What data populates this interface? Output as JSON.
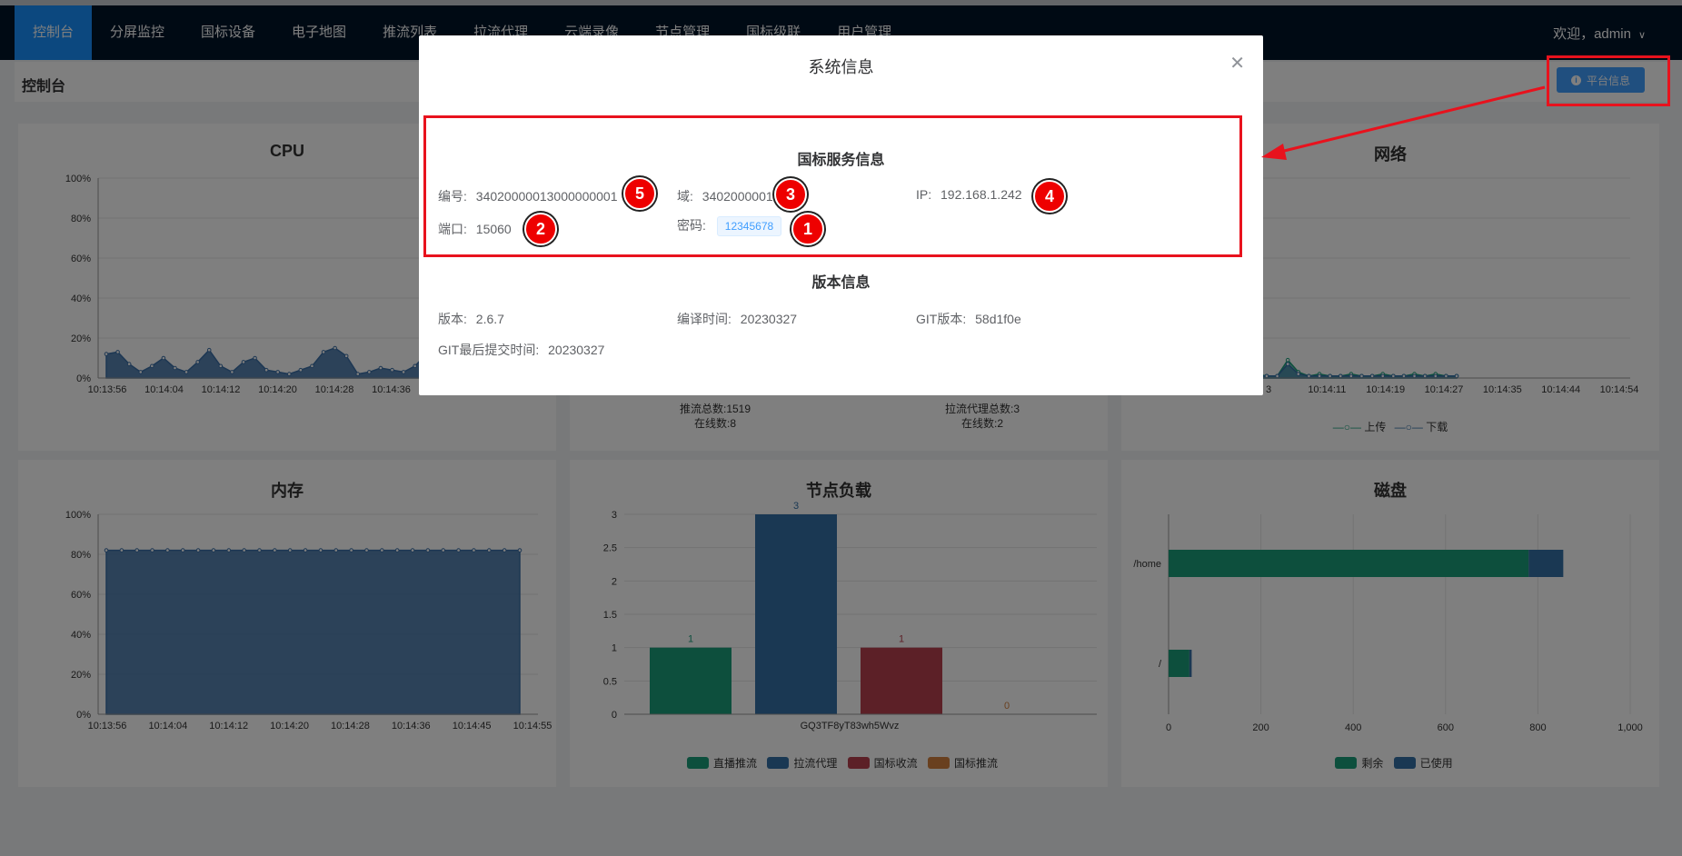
{
  "nav": {
    "items": [
      "控制台",
      "分屏监控",
      "国标设备",
      "电子地图",
      "推流列表",
      "拉流代理",
      "云端录像",
      "节点管理",
      "国标级联",
      "用户管理"
    ],
    "user": "欢迎，admin"
  },
  "header": {
    "title": "控制台",
    "platform_button": "平台信息"
  },
  "panels": {
    "cpu": {
      "title": "CPU"
    },
    "network": {
      "title": "网络",
      "legend": [
        "上传",
        "下载"
      ]
    },
    "memory": {
      "title": "内存"
    },
    "node_load": {
      "title": "节点负载",
      "legend": [
        "直播推流",
        "拉流代理",
        "国标收流",
        "国标推流"
      ]
    },
    "disk": {
      "title": "磁盘",
      "legend": [
        "剩余",
        "已使用"
      ]
    },
    "stats": {
      "push_total": "推流总数:1519",
      "push_online": "在线数:8",
      "proxy_total": "拉流代理总数:3",
      "proxy_online": "在线数:2"
    }
  },
  "modal": {
    "title": "系统信息",
    "gb_section": "国标服务信息",
    "gb": {
      "id_label": "编号:",
      "id_value": "34020000013000000001",
      "domain_label": "域:",
      "domain_value": "3402000001",
      "ip_label": "IP:",
      "ip_value": "192.168.1.242",
      "port_label": "端口:",
      "port_value": "15060",
      "password_label": "密码:",
      "password_value": "12345678"
    },
    "version_section": "版本信息",
    "version": {
      "version_label": "版本:",
      "version_value": "2.6.7",
      "build_label": "编译时间:",
      "build_value": "20230327",
      "git_label": "GIT版本:",
      "git_value": "58d1f0e",
      "commit_label": "GIT最后提交时间:",
      "commit_value": "20230327"
    }
  },
  "badges": [
    "5",
    "3",
    "4",
    "2",
    "1"
  ],
  "colors": {
    "nav": "#001529",
    "accent": "#1890ff",
    "annotation": "#e8121d"
  },
  "chart_data": [
    {
      "type": "area",
      "title": "CPU",
      "x": [
        "10:13:56",
        "10:14:04",
        "10:14:12",
        "10:14:20",
        "10:14:28",
        "10:14:36"
      ],
      "y_ticks": [
        "0%",
        "20%",
        "40%",
        "60%",
        "80%",
        "100%"
      ],
      "ylim": [
        0,
        100
      ],
      "values": [
        12,
        13,
        7,
        3,
        6,
        10,
        5,
        3,
        8,
        14,
        6,
        3,
        8,
        10,
        4,
        3,
        2,
        4,
        6,
        13,
        15,
        11,
        2,
        3,
        5,
        4,
        3,
        6,
        12,
        13,
        11,
        8
      ]
    },
    {
      "type": "area",
      "title": "网络",
      "x": [
        "3",
        "10:14:11",
        "10:14:19",
        "10:14:27",
        "10:14:35",
        "10:14:44",
        "10:14:54"
      ],
      "series": [
        {
          "name": "上传",
          "values": [
            8,
            5,
            2,
            1,
            2,
            1,
            3,
            1,
            2,
            1,
            6,
            1,
            2,
            1,
            1,
            9,
            3,
            1,
            2,
            1,
            1,
            2,
            1,
            1,
            2,
            1,
            1,
            2,
            1,
            2,
            1,
            1
          ]
        },
        {
          "name": "下载",
          "values": [
            6,
            4,
            2,
            1,
            1,
            1,
            2,
            1,
            1,
            1,
            4,
            1,
            1,
            1,
            1,
            7,
            2,
            1,
            1,
            1,
            1,
            1,
            1,
            1,
            1,
            1,
            1,
            1,
            1,
            1,
            1,
            1
          ]
        }
      ]
    },
    {
      "type": "area",
      "title": "内存",
      "x": [
        "10:13:56",
        "10:14:04",
        "10:14:12",
        "10:14:20",
        "10:14:28",
        "10:14:36",
        "10:14:45",
        "10:14:55"
      ],
      "y_ticks": [
        "0%",
        "20%",
        "40%",
        "60%",
        "80%",
        "100%"
      ],
      "ylim": [
        0,
        100
      ],
      "values": [
        82,
        82,
        82,
        82,
        82,
        82,
        82,
        82,
        82,
        82,
        82,
        82,
        82,
        82,
        82,
        82,
        82,
        82,
        82,
        82,
        82,
        82,
        82,
        82,
        82,
        82,
        82,
        82
      ]
    },
    {
      "type": "bar",
      "title": "节点负载",
      "categories": [
        "GQ3TF8yT83wh5Wvz"
      ],
      "series": [
        {
          "name": "直播推流",
          "values": [
            1
          ],
          "color": "#1a9e7b"
        },
        {
          "name": "拉流代理",
          "values": [
            3
          ],
          "color": "#3470a6"
        },
        {
          "name": "国标收流",
          "values": [
            1
          ],
          "color": "#b8404f"
        },
        {
          "name": "国标推流",
          "values": [
            0
          ],
          "color": "#d2813f"
        }
      ],
      "y_ticks": [
        "0",
        "0.5",
        "1",
        "1.5",
        "2",
        "2.5",
        "3"
      ],
      "ylim": [
        0,
        3
      ]
    },
    {
      "type": "bar",
      "title": "磁盘",
      "orientation": "horizontal",
      "categories": [
        "/home",
        "/"
      ],
      "series": [
        {
          "name": "剩余",
          "values": [
            780,
            45
          ],
          "color": "#1a9e7b"
        },
        {
          "name": "已使用",
          "values": [
            75,
            5
          ],
          "color": "#3470a6"
        }
      ],
      "x_ticks": [
        "0",
        "200",
        "400",
        "600",
        "800",
        "1,000"
      ],
      "xlim": [
        0,
        1000
      ]
    }
  ]
}
